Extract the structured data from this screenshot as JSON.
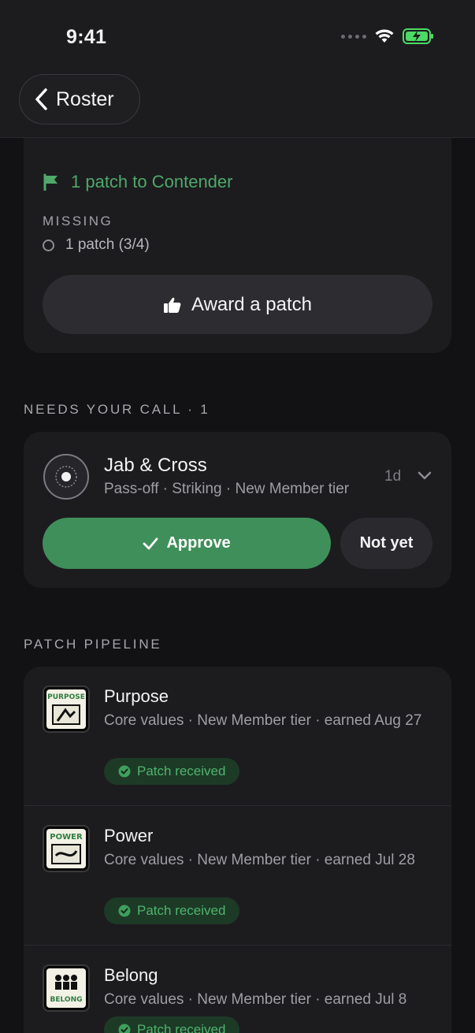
{
  "status_bar": {
    "time": "9:41"
  },
  "nav": {
    "back_label": "Roster"
  },
  "progress_card": {
    "next_step": "1 patch to Contender",
    "missing_heading": "MISSING",
    "missing_items": [
      "1 patch (3/4)"
    ],
    "award_button": "Award a patch"
  },
  "needs_call": {
    "heading": "NEEDS YOUR CALL · 1",
    "item": {
      "title": "Jab & Cross",
      "subtitle": "Pass-off · Striking · New Member tier",
      "age": "1d",
      "approve_label": "Approve",
      "reject_label": "Not yet"
    }
  },
  "pipeline": {
    "heading": "PATCH PIPELINE",
    "items": [
      {
        "title": "Purpose",
        "subtitle": "Core values · New Member tier · earned Aug 27",
        "badge": "Patch received",
        "patch_text": "PURPOSE"
      },
      {
        "title": "Power",
        "subtitle": "Core values · New Member tier · earned Jul 28",
        "badge": "Patch received",
        "patch_text": "POWER"
      },
      {
        "title": "Belong",
        "subtitle": "Core values · New Member tier · earned Jul 8",
        "badge": "Patch received",
        "patch_text": "BELONG"
      }
    ]
  },
  "colors": {
    "accent_green": "#3f8f5a",
    "background": "#121214",
    "card": "#1c1c1f"
  }
}
